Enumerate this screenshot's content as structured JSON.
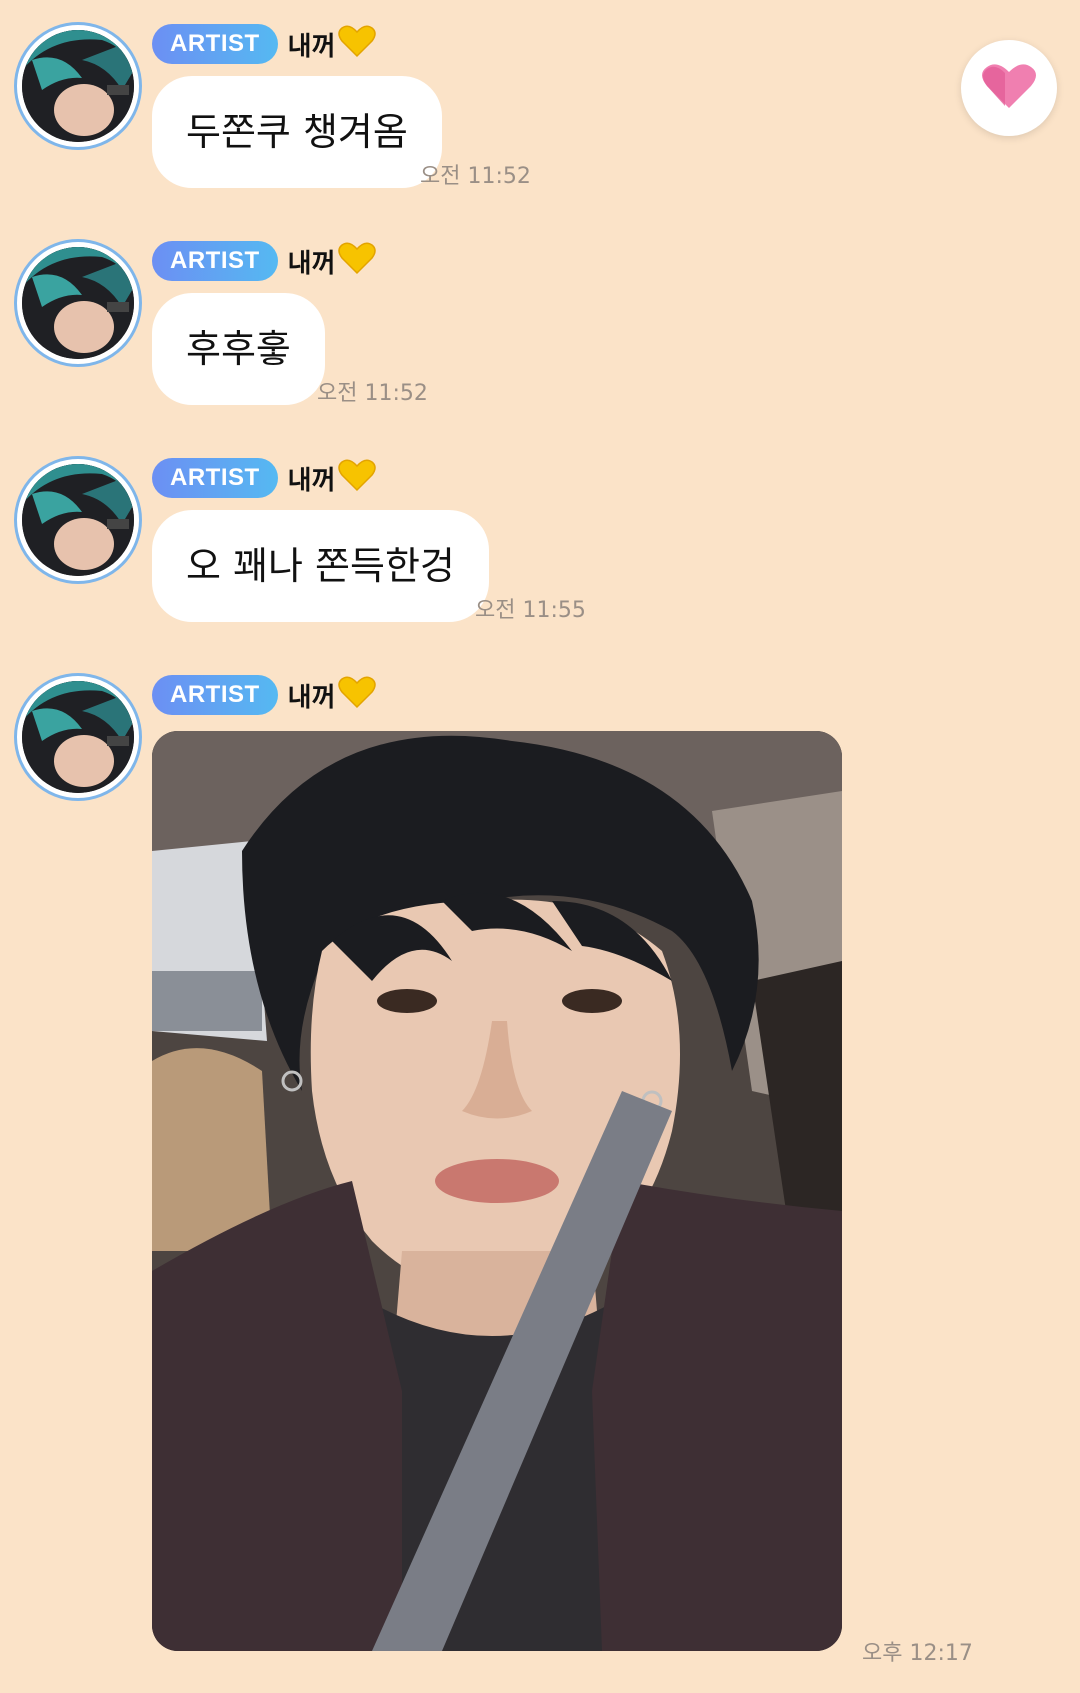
{
  "messages": [
    {
      "badge": "ARTIST",
      "nickname": "내꺼",
      "text": "두쫀쿠 챙겨옴",
      "time": "오전 11:52"
    },
    {
      "badge": "ARTIST",
      "nickname": "내꺼",
      "text": "후후훟",
      "time": "오전 11:52"
    },
    {
      "badge": "ARTIST",
      "nickname": "내꺼",
      "text": "오 꽤나 쫀득한겅",
      "time": "오전 11:55"
    },
    {
      "badge": "ARTIST",
      "nickname": "내꺼",
      "time": "오후 12:17"
    }
  ],
  "colors": {
    "background": "#fbe3c8",
    "bubble": "#ffffff",
    "badge_start": "#6c8ff3",
    "badge_end": "#55b9f2",
    "heart": "#e9609a",
    "timestamp": "#9a8f86"
  },
  "icons": {
    "nickname_emoji": "yellow-heart-icon",
    "fab": "heart-reaction-icon"
  }
}
